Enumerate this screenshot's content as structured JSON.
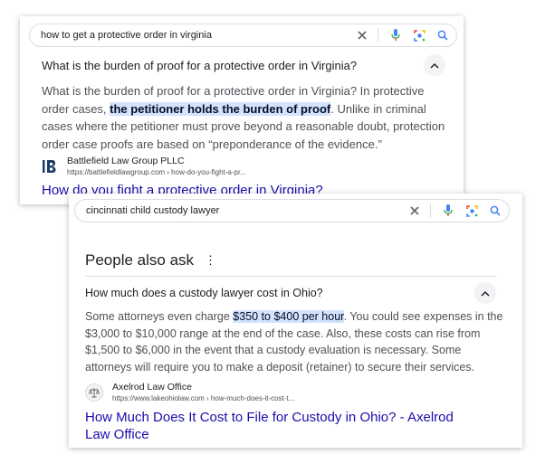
{
  "card1": {
    "search": {
      "query": "how to get a protective order in virginia"
    },
    "question": "What is the burden of proof for a protective order in Virginia?",
    "answer": {
      "part1": "What is the burden of proof for a protective order in Virginia? In protective order cases, ",
      "highlight": "the petitioner holds the burden of proof",
      "part2": ". Unlike in criminal cases where the petitioner must prove beyond a reasonable doubt, protection order case proofs are based on “preponderance of the evidence.”"
    },
    "source": {
      "name": "Battlefield Law Group PLLC",
      "url": "https://battlefieldlawgroup.com › how-do-you-fight-a-pr...",
      "logo_text": "B"
    },
    "link": "How do you fight a protective order in Virginia?"
  },
  "card2": {
    "search": {
      "query": "cincinnati child custody lawyer"
    },
    "section_title": "People also ask",
    "more_icon": "⋮",
    "question": "How much does a custody lawyer cost in Ohio?",
    "answer": {
      "part1": "Some attorneys even charge ",
      "highlight": "$350 to $400 per hour",
      "part2": ". You could see expenses in the $3,000 to $10,000 range at the end of the case. Also, these costs can rise from $1,500 to $6,000 in the event that a custody evaluation is necessary. Some attorneys will require you to make a deposit (retainer) to secure their services."
    },
    "source": {
      "name": "Axelrod Law Office",
      "url": "https://www.lakeohiolaw.com › how-much-does-it-cost-t..."
    },
    "link": "How Much Does It Cost to File for Custody in Ohio? - Axelrod Law Office"
  },
  "icons": {
    "clear": "close-icon",
    "voice": "microphone-icon",
    "lens": "lens-icon",
    "search": "search-icon",
    "collapse": "chevron-up-icon"
  },
  "colors": {
    "link": "#1a0dab",
    "highlight": "#d3e3fd",
    "search_blue": "#4285f4"
  }
}
